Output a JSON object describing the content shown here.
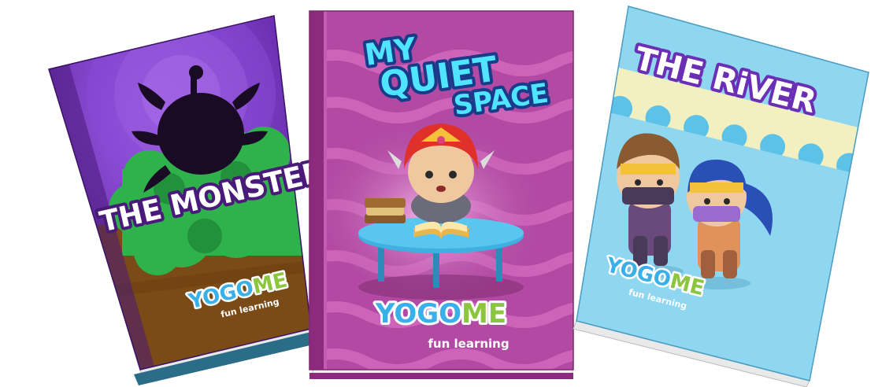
{
  "books": [
    {
      "title": "THE MONSTER",
      "brand": {
        "part1": "YOGO",
        "part2": "ME",
        "tagline": "fun learning"
      },
      "colors": {
        "sky": "#7b3fc4",
        "ground": "#7a4b16",
        "bush": "#2fb24c",
        "title_fill": "#ffffff",
        "title_stroke": "#4a1a7a"
      }
    },
    {
      "title_lines": [
        "MY",
        "QUIET",
        "SPACE"
      ],
      "brand": {
        "part1": "YOGO",
        "part2": "ME",
        "tagline": "fun learning"
      },
      "colors": {
        "background": "#b24aa3",
        "wave": "#d46bc0",
        "title_fill": "#4fe4ff",
        "title_stroke": "#1a3b8a",
        "table": "#3fb0e0"
      }
    },
    {
      "title": "THE RiVER",
      "brand": {
        "part1": "YOGO",
        "part2": "ME",
        "tagline": "fun learning"
      },
      "colors": {
        "sky": "#8fd6f0",
        "waves": "#f2efc0",
        "title_fill": "#ffffff",
        "title_stroke": "#6a2fb5"
      }
    }
  ]
}
